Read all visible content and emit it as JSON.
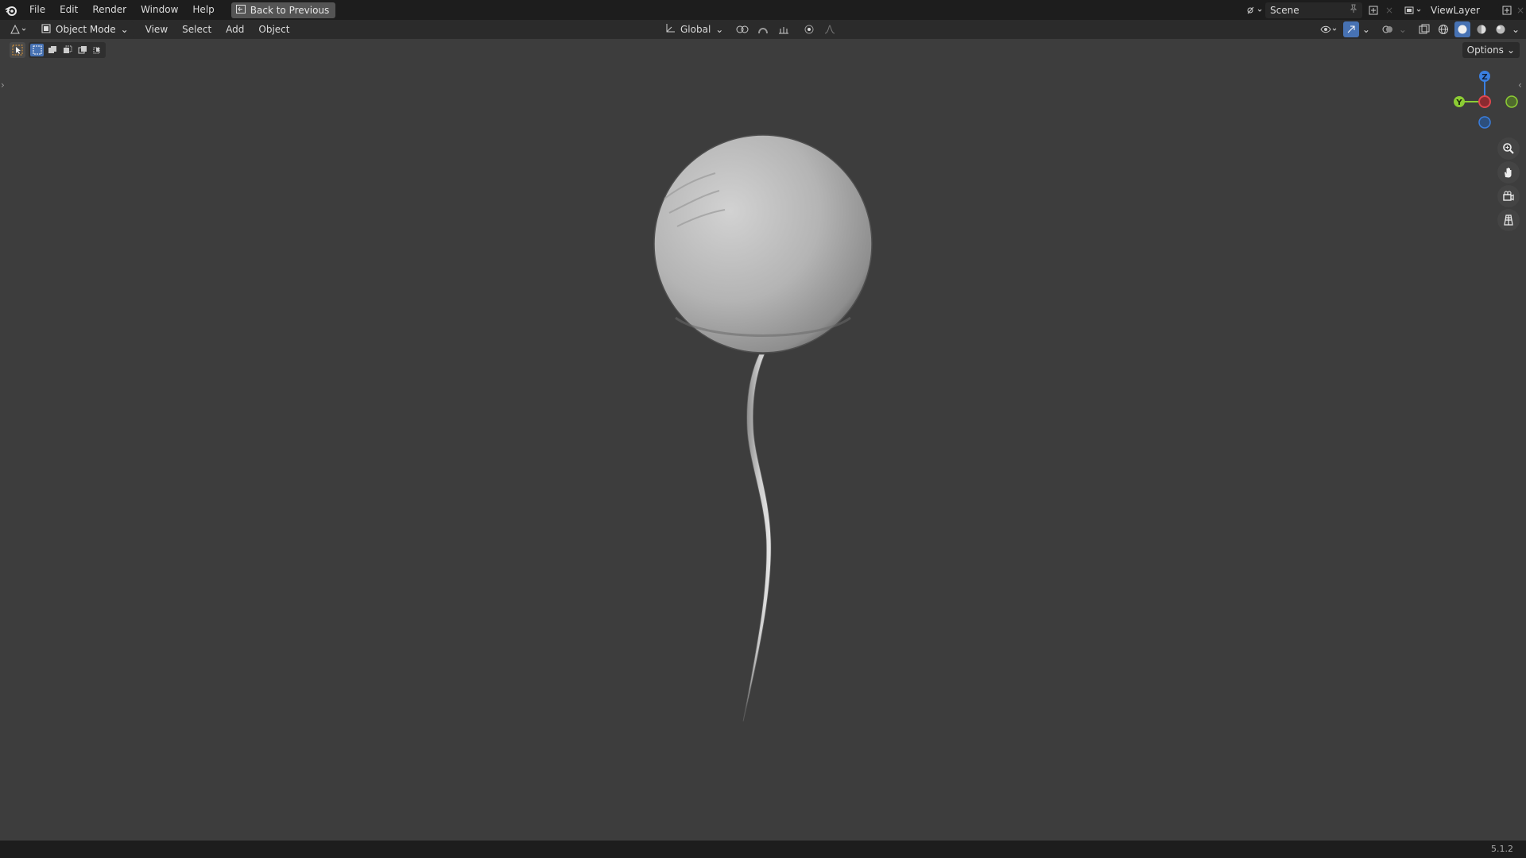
{
  "topbar": {
    "menu": [
      "File",
      "Edit",
      "Render",
      "Window",
      "Help"
    ],
    "back_label": "Back to Previous",
    "scene_label": "Scene",
    "viewlayer_label": "ViewLayer"
  },
  "header": {
    "mode_label": "Object Mode",
    "menu": [
      "View",
      "Select",
      "Add",
      "Object"
    ],
    "transform_orientation": "Global"
  },
  "viewport": {
    "options_label": "Options",
    "gizmo": {
      "z_label": "Z",
      "y_label": "Y"
    },
    "colors": {
      "background": "#3d3d3d",
      "x_axis": "#e0464d",
      "y_axis": "#8ccc34",
      "z_axis": "#3a7fe0"
    }
  },
  "icons": {
    "topbar": [
      "blender-logo-icon",
      "back-icon",
      "scene-icon",
      "pin-icon",
      "new-scene-icon",
      "viewlayer-icon",
      "new-viewlayer-icon"
    ],
    "header": [
      "editor-type-icon",
      "object-mode-icon",
      "transform-orientation-icon",
      "pivot-icon",
      "snap-icon",
      "snap-target-icon",
      "proportional-icon",
      "falloff-icon",
      "visibility-icon",
      "gizmo-icon",
      "overlay-icon",
      "xray-icon",
      "wireframe-shading-icon",
      "solid-shading-icon",
      "material-shading-icon",
      "rendered-shading-icon"
    ],
    "navigation": [
      "zoom-icon",
      "pan-hand-icon",
      "camera-view-icon",
      "ortho-grid-icon"
    ]
  },
  "status": {
    "version": "5.1.2"
  }
}
